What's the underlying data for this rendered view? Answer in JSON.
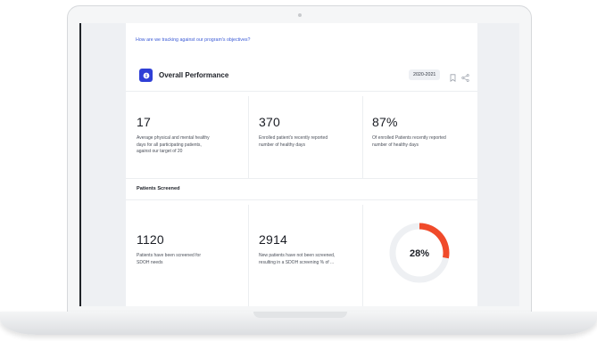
{
  "dashboard": {
    "question_link": "How are we tracking against our program's objectives?",
    "title": "Overall Performance",
    "year": "2020-2021",
    "metrics": [
      {
        "value": "17",
        "desc_lines": [
          "Average physical and mental healthy",
          "days for all participating patients,",
          "against our target of 20"
        ]
      },
      {
        "value": "370",
        "desc_lines": [
          "Enrolled patient's recently reported",
          "number of healthy days"
        ]
      },
      {
        "value": "87%",
        "desc_lines": [
          "Of enrolled Patients recently reported",
          "number of healthy days"
        ]
      }
    ],
    "section_label": "Patients Screened",
    "screened": [
      {
        "value": "1120",
        "desc_lines": [
          "Patients have been screened for",
          "SDOH needs"
        ]
      },
      {
        "value": "2914",
        "desc_lines": [
          "New patients have not been screened,",
          "resulting in a SDOH screening % of ..."
        ]
      }
    ],
    "donut": {
      "label": "28%",
      "fraction": 0.28,
      "color": "#f04a2a",
      "track_color": "#eef0f3"
    }
  }
}
